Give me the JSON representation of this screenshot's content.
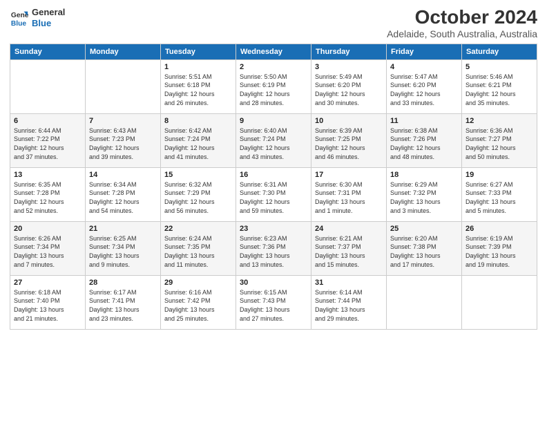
{
  "logo": {
    "line1": "General",
    "line2": "Blue"
  },
  "title": "October 2024",
  "subtitle": "Adelaide, South Australia, Australia",
  "weekdays": [
    "Sunday",
    "Monday",
    "Tuesday",
    "Wednesday",
    "Thursday",
    "Friday",
    "Saturday"
  ],
  "weeks": [
    [
      {
        "day": "",
        "info": ""
      },
      {
        "day": "",
        "info": ""
      },
      {
        "day": "1",
        "info": "Sunrise: 5:51 AM\nSunset: 6:18 PM\nDaylight: 12 hours\nand 26 minutes."
      },
      {
        "day": "2",
        "info": "Sunrise: 5:50 AM\nSunset: 6:19 PM\nDaylight: 12 hours\nand 28 minutes."
      },
      {
        "day": "3",
        "info": "Sunrise: 5:49 AM\nSunset: 6:20 PM\nDaylight: 12 hours\nand 30 minutes."
      },
      {
        "day": "4",
        "info": "Sunrise: 5:47 AM\nSunset: 6:20 PM\nDaylight: 12 hours\nand 33 minutes."
      },
      {
        "day": "5",
        "info": "Sunrise: 5:46 AM\nSunset: 6:21 PM\nDaylight: 12 hours\nand 35 minutes."
      }
    ],
    [
      {
        "day": "6",
        "info": "Sunrise: 6:44 AM\nSunset: 7:22 PM\nDaylight: 12 hours\nand 37 minutes."
      },
      {
        "day": "7",
        "info": "Sunrise: 6:43 AM\nSunset: 7:23 PM\nDaylight: 12 hours\nand 39 minutes."
      },
      {
        "day": "8",
        "info": "Sunrise: 6:42 AM\nSunset: 7:24 PM\nDaylight: 12 hours\nand 41 minutes."
      },
      {
        "day": "9",
        "info": "Sunrise: 6:40 AM\nSunset: 7:24 PM\nDaylight: 12 hours\nand 43 minutes."
      },
      {
        "day": "10",
        "info": "Sunrise: 6:39 AM\nSunset: 7:25 PM\nDaylight: 12 hours\nand 46 minutes."
      },
      {
        "day": "11",
        "info": "Sunrise: 6:38 AM\nSunset: 7:26 PM\nDaylight: 12 hours\nand 48 minutes."
      },
      {
        "day": "12",
        "info": "Sunrise: 6:36 AM\nSunset: 7:27 PM\nDaylight: 12 hours\nand 50 minutes."
      }
    ],
    [
      {
        "day": "13",
        "info": "Sunrise: 6:35 AM\nSunset: 7:28 PM\nDaylight: 12 hours\nand 52 minutes."
      },
      {
        "day": "14",
        "info": "Sunrise: 6:34 AM\nSunset: 7:28 PM\nDaylight: 12 hours\nand 54 minutes."
      },
      {
        "day": "15",
        "info": "Sunrise: 6:32 AM\nSunset: 7:29 PM\nDaylight: 12 hours\nand 56 minutes."
      },
      {
        "day": "16",
        "info": "Sunrise: 6:31 AM\nSunset: 7:30 PM\nDaylight: 12 hours\nand 59 minutes."
      },
      {
        "day": "17",
        "info": "Sunrise: 6:30 AM\nSunset: 7:31 PM\nDaylight: 13 hours\nand 1 minute."
      },
      {
        "day": "18",
        "info": "Sunrise: 6:29 AM\nSunset: 7:32 PM\nDaylight: 13 hours\nand 3 minutes."
      },
      {
        "day": "19",
        "info": "Sunrise: 6:27 AM\nSunset: 7:33 PM\nDaylight: 13 hours\nand 5 minutes."
      }
    ],
    [
      {
        "day": "20",
        "info": "Sunrise: 6:26 AM\nSunset: 7:34 PM\nDaylight: 13 hours\nand 7 minutes."
      },
      {
        "day": "21",
        "info": "Sunrise: 6:25 AM\nSunset: 7:34 PM\nDaylight: 13 hours\nand 9 minutes."
      },
      {
        "day": "22",
        "info": "Sunrise: 6:24 AM\nSunset: 7:35 PM\nDaylight: 13 hours\nand 11 minutes."
      },
      {
        "day": "23",
        "info": "Sunrise: 6:23 AM\nSunset: 7:36 PM\nDaylight: 13 hours\nand 13 minutes."
      },
      {
        "day": "24",
        "info": "Sunrise: 6:21 AM\nSunset: 7:37 PM\nDaylight: 13 hours\nand 15 minutes."
      },
      {
        "day": "25",
        "info": "Sunrise: 6:20 AM\nSunset: 7:38 PM\nDaylight: 13 hours\nand 17 minutes."
      },
      {
        "day": "26",
        "info": "Sunrise: 6:19 AM\nSunset: 7:39 PM\nDaylight: 13 hours\nand 19 minutes."
      }
    ],
    [
      {
        "day": "27",
        "info": "Sunrise: 6:18 AM\nSunset: 7:40 PM\nDaylight: 13 hours\nand 21 minutes."
      },
      {
        "day": "28",
        "info": "Sunrise: 6:17 AM\nSunset: 7:41 PM\nDaylight: 13 hours\nand 23 minutes."
      },
      {
        "day": "29",
        "info": "Sunrise: 6:16 AM\nSunset: 7:42 PM\nDaylight: 13 hours\nand 25 minutes."
      },
      {
        "day": "30",
        "info": "Sunrise: 6:15 AM\nSunset: 7:43 PM\nDaylight: 13 hours\nand 27 minutes."
      },
      {
        "day": "31",
        "info": "Sunrise: 6:14 AM\nSunset: 7:44 PM\nDaylight: 13 hours\nand 29 minutes."
      },
      {
        "day": "",
        "info": ""
      },
      {
        "day": "",
        "info": ""
      }
    ]
  ]
}
